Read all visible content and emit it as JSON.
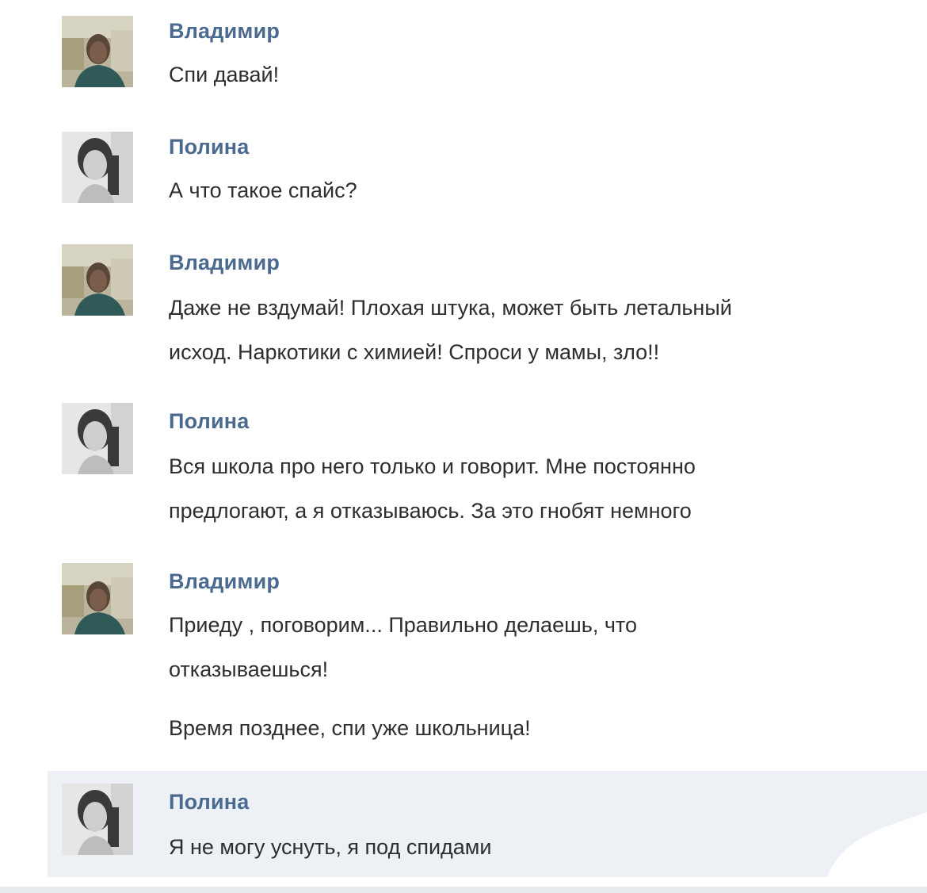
{
  "conversation": {
    "messages": [
      {
        "author": "Владимир",
        "avatar_icon": "male-user-avatar-icon",
        "lines": [
          "Спи давай!"
        ]
      },
      {
        "author": "Полина",
        "avatar_icon": "female-user-avatar-icon",
        "lines": [
          "А что такое спайс?"
        ]
      },
      {
        "author": "Владимир",
        "avatar_icon": "male-user-avatar-icon",
        "lines": [
          "Даже не вздумай! Плохая штука, может быть летальный",
          "исход. Наркотики с химией! Спроси у мамы, зло!!"
        ]
      },
      {
        "author": "Полина",
        "avatar_icon": "female-user-avatar-icon",
        "lines": [
          "Вся школа про него только и говорит. Мне постоянно",
          "предлогают, а я отказываюсь. За это гнобят немного"
        ]
      },
      {
        "author": "Владимир",
        "avatar_icon": "male-user-avatar-icon",
        "lines": [
          "Приеду , поговорим... Правильно делаешь, что",
          "отказываешься!"
        ],
        "extra_line": "Время позднее, спи уже школьница!"
      },
      {
        "author": "Полина",
        "avatar_icon": "female-user-avatar-icon",
        "lines": [
          "Я не могу уснуть, я под спидами"
        ],
        "highlighted": true
      }
    ]
  },
  "colors": {
    "author_name": "#4b6a90",
    "message_text": "#2e2e2e",
    "highlight_bg": "#edf1f5"
  }
}
